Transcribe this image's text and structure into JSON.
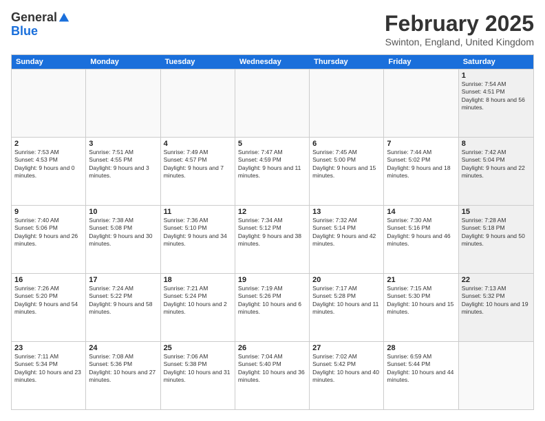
{
  "header": {
    "logo_general": "General",
    "logo_blue": "Blue",
    "month_title": "February 2025",
    "location": "Swinton, England, United Kingdom"
  },
  "days_of_week": [
    "Sunday",
    "Monday",
    "Tuesday",
    "Wednesday",
    "Thursday",
    "Friday",
    "Saturday"
  ],
  "rows": [
    [
      {
        "day": "",
        "info": "",
        "empty": true
      },
      {
        "day": "",
        "info": "",
        "empty": true
      },
      {
        "day": "",
        "info": "",
        "empty": true
      },
      {
        "day": "",
        "info": "",
        "empty": true
      },
      {
        "day": "",
        "info": "",
        "empty": true
      },
      {
        "day": "",
        "info": "",
        "empty": true
      },
      {
        "day": "1",
        "info": "Sunrise: 7:54 AM\nSunset: 4:51 PM\nDaylight: 8 hours and 56 minutes.",
        "shaded": true
      }
    ],
    [
      {
        "day": "2",
        "info": "Sunrise: 7:53 AM\nSunset: 4:53 PM\nDaylight: 9 hours and 0 minutes."
      },
      {
        "day": "3",
        "info": "Sunrise: 7:51 AM\nSunset: 4:55 PM\nDaylight: 9 hours and 3 minutes."
      },
      {
        "day": "4",
        "info": "Sunrise: 7:49 AM\nSunset: 4:57 PM\nDaylight: 9 hours and 7 minutes."
      },
      {
        "day": "5",
        "info": "Sunrise: 7:47 AM\nSunset: 4:59 PM\nDaylight: 9 hours and 11 minutes."
      },
      {
        "day": "6",
        "info": "Sunrise: 7:45 AM\nSunset: 5:00 PM\nDaylight: 9 hours and 15 minutes."
      },
      {
        "day": "7",
        "info": "Sunrise: 7:44 AM\nSunset: 5:02 PM\nDaylight: 9 hours and 18 minutes."
      },
      {
        "day": "8",
        "info": "Sunrise: 7:42 AM\nSunset: 5:04 PM\nDaylight: 9 hours and 22 minutes.",
        "shaded": true
      }
    ],
    [
      {
        "day": "9",
        "info": "Sunrise: 7:40 AM\nSunset: 5:06 PM\nDaylight: 9 hours and 26 minutes."
      },
      {
        "day": "10",
        "info": "Sunrise: 7:38 AM\nSunset: 5:08 PM\nDaylight: 9 hours and 30 minutes."
      },
      {
        "day": "11",
        "info": "Sunrise: 7:36 AM\nSunset: 5:10 PM\nDaylight: 9 hours and 34 minutes."
      },
      {
        "day": "12",
        "info": "Sunrise: 7:34 AM\nSunset: 5:12 PM\nDaylight: 9 hours and 38 minutes."
      },
      {
        "day": "13",
        "info": "Sunrise: 7:32 AM\nSunset: 5:14 PM\nDaylight: 9 hours and 42 minutes."
      },
      {
        "day": "14",
        "info": "Sunrise: 7:30 AM\nSunset: 5:16 PM\nDaylight: 9 hours and 46 minutes."
      },
      {
        "day": "15",
        "info": "Sunrise: 7:28 AM\nSunset: 5:18 PM\nDaylight: 9 hours and 50 minutes.",
        "shaded": true
      }
    ],
    [
      {
        "day": "16",
        "info": "Sunrise: 7:26 AM\nSunset: 5:20 PM\nDaylight: 9 hours and 54 minutes."
      },
      {
        "day": "17",
        "info": "Sunrise: 7:24 AM\nSunset: 5:22 PM\nDaylight: 9 hours and 58 minutes."
      },
      {
        "day": "18",
        "info": "Sunrise: 7:21 AM\nSunset: 5:24 PM\nDaylight: 10 hours and 2 minutes."
      },
      {
        "day": "19",
        "info": "Sunrise: 7:19 AM\nSunset: 5:26 PM\nDaylight: 10 hours and 6 minutes."
      },
      {
        "day": "20",
        "info": "Sunrise: 7:17 AM\nSunset: 5:28 PM\nDaylight: 10 hours and 11 minutes."
      },
      {
        "day": "21",
        "info": "Sunrise: 7:15 AM\nSunset: 5:30 PM\nDaylight: 10 hours and 15 minutes."
      },
      {
        "day": "22",
        "info": "Sunrise: 7:13 AM\nSunset: 5:32 PM\nDaylight: 10 hours and 19 minutes.",
        "shaded": true
      }
    ],
    [
      {
        "day": "23",
        "info": "Sunrise: 7:11 AM\nSunset: 5:34 PM\nDaylight: 10 hours and 23 minutes."
      },
      {
        "day": "24",
        "info": "Sunrise: 7:08 AM\nSunset: 5:36 PM\nDaylight: 10 hours and 27 minutes."
      },
      {
        "day": "25",
        "info": "Sunrise: 7:06 AM\nSunset: 5:38 PM\nDaylight: 10 hours and 31 minutes."
      },
      {
        "day": "26",
        "info": "Sunrise: 7:04 AM\nSunset: 5:40 PM\nDaylight: 10 hours and 36 minutes."
      },
      {
        "day": "27",
        "info": "Sunrise: 7:02 AM\nSunset: 5:42 PM\nDaylight: 10 hours and 40 minutes."
      },
      {
        "day": "28",
        "info": "Sunrise: 6:59 AM\nSunset: 5:44 PM\nDaylight: 10 hours and 44 minutes."
      },
      {
        "day": "",
        "info": "",
        "empty": true
      }
    ]
  ]
}
